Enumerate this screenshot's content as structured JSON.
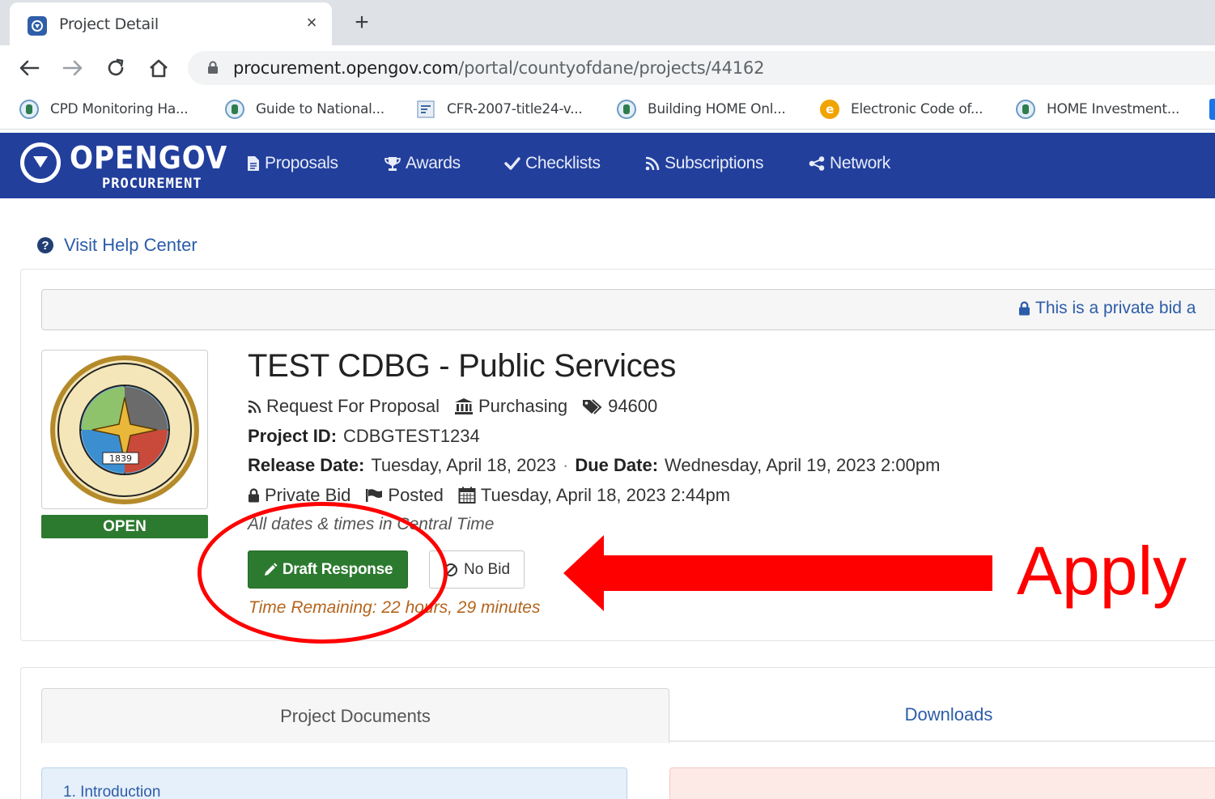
{
  "browser": {
    "tab_title": "Project Detail",
    "tab_close": "×",
    "new_tab": "+",
    "url_host": "procurement.opengov.com",
    "url_path": "/portal/countyofdane/projects/44162",
    "bookmarks": [
      {
        "label": "CPD Monitoring Ha...",
        "icon": "hud-seal-icon"
      },
      {
        "label": "Guide to National...",
        "icon": "hud-seal-icon"
      },
      {
        "label": "CFR-2007-title24-v...",
        "icon": "document-icon"
      },
      {
        "label": "Building HOME Onl...",
        "icon": "hud-seal-icon"
      },
      {
        "label": "Electronic Code of...",
        "icon": "ecfr-icon",
        "icon_text": "e"
      },
      {
        "label": "HOME Investment...",
        "icon": "hud-seal-icon"
      }
    ]
  },
  "site": {
    "logo_word": "OPENGOV",
    "logo_sub": "PROCUREMENT",
    "nav": [
      {
        "label": "Proposals",
        "icon": "file-icon"
      },
      {
        "label": "Awards",
        "icon": "trophy-icon"
      },
      {
        "label": "Checklists",
        "icon": "check-icon"
      },
      {
        "label": "Subscriptions",
        "icon": "rss-icon"
      },
      {
        "label": "Network",
        "icon": "share-icon"
      }
    ],
    "colors": {
      "nav_bg": "#223f9c",
      "primary": "#2c7a2f",
      "link": "#2c5ca8",
      "warning": "#b5651d"
    }
  },
  "help": {
    "label": "Visit Help Center",
    "icon_text": "?"
  },
  "private_note": "This is a private bid a",
  "project": {
    "status": "OPEN",
    "title": "TEST CDBG - Public Services",
    "type": "Request For Proposal",
    "department": "Purchasing",
    "tag": "94600",
    "project_id_label": "Project ID:",
    "project_id": "CDBGTEST1234",
    "release_label": "Release Date:",
    "release_date": "Tuesday, April 18, 2023",
    "due_label": "Due Date:",
    "due_date": "Wednesday, April 19, 2023 2:00pm",
    "privacy": "Private Bid",
    "posted": "Posted",
    "posted_date": "Tuesday, April 18, 2023 2:44pm",
    "tz_note": "All dates & times in Central Time",
    "draft_button": "Draft Response",
    "nobid_button": "No Bid",
    "time_remaining": "Time Remaining: 22 hours, 29 minutes"
  },
  "annotation": {
    "label": "Apply",
    "color": "#ff0000"
  },
  "seal": {
    "year": "1839"
  },
  "documents": {
    "tabs": [
      "Project Documents",
      "Downloads"
    ],
    "toc_first": "1. Introduction"
  }
}
